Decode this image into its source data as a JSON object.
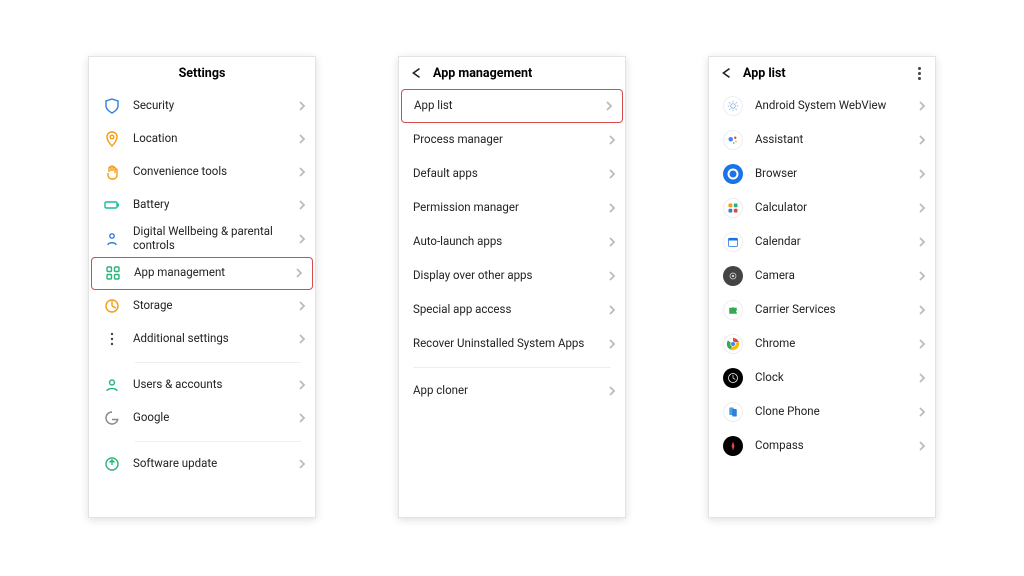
{
  "screens": {
    "settings": {
      "title": "Settings",
      "items": [
        {
          "label": "Security",
          "icon": "shield-icon",
          "color": "#2f7de1"
        },
        {
          "label": "Location",
          "icon": "pin-icon",
          "color": "#f39c12"
        },
        {
          "label": "Convenience tools",
          "icon": "hand-icon",
          "color": "#f39c12"
        },
        {
          "label": "Battery",
          "icon": "battery-icon",
          "color": "#1abc9c"
        },
        {
          "label": "Digital Wellbeing & parental controls",
          "icon": "wellbeing-icon",
          "color": "#2f7de1",
          "multiline": true
        },
        {
          "label": "App management",
          "icon": "apps-icon",
          "color": "#29b57a",
          "highlight": true
        },
        {
          "label": "Storage",
          "icon": "storage-icon",
          "color": "#f39c12"
        },
        {
          "label": "Additional settings",
          "icon": "dots-icon",
          "color": "#444"
        }
      ],
      "group2": [
        {
          "label": "Users & accounts",
          "icon": "user-icon",
          "color": "#29b57a"
        },
        {
          "label": "Google",
          "icon": "google-icon",
          "color": "#888"
        }
      ],
      "group3": [
        {
          "label": "Software update",
          "icon": "update-icon",
          "color": "#29b57a"
        }
      ]
    },
    "appmgmt": {
      "title": "App management",
      "items": [
        {
          "label": "App list",
          "highlight": true
        },
        {
          "label": "Process manager"
        },
        {
          "label": "Default apps"
        },
        {
          "label": "Permission manager"
        },
        {
          "label": "Auto-launch apps"
        },
        {
          "label": "Display over other apps"
        },
        {
          "label": "Special app access"
        },
        {
          "label": "Recover Uninstalled System Apps"
        }
      ],
      "group2": [
        {
          "label": "App cloner"
        }
      ]
    },
    "applist": {
      "title": "App list",
      "items": [
        {
          "label": "Android System WebView",
          "icon": "gear-icon",
          "bg": "#fff",
          "fg": "#6fa8dc"
        },
        {
          "label": "Assistant",
          "icon": "assistant-icon",
          "bg": "#fff"
        },
        {
          "label": "Browser",
          "icon": "browser-icon",
          "bg": "#1a73e8",
          "fg": "#fff"
        },
        {
          "label": "Calculator",
          "icon": "calculator-icon",
          "bg": "#fff"
        },
        {
          "label": "Calendar",
          "icon": "calendar-icon",
          "bg": "#fff"
        },
        {
          "label": "Camera",
          "icon": "camera-icon",
          "bg": "#444",
          "fg": "#fff"
        },
        {
          "label": "Carrier Services",
          "icon": "puzzle-icon",
          "bg": "#fff"
        },
        {
          "label": "Chrome",
          "icon": "chrome-icon",
          "bg": "#fff"
        },
        {
          "label": "Clock",
          "icon": "clock-icon",
          "bg": "#000",
          "fg": "#fff"
        },
        {
          "label": "Clone Phone",
          "icon": "clone-icon",
          "bg": "#fff"
        },
        {
          "label": "Compass",
          "icon": "compass-icon",
          "bg": "#000",
          "fg": "#d94a4a"
        }
      ]
    }
  }
}
